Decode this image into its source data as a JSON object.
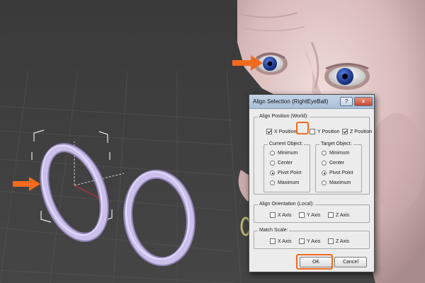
{
  "dialog": {
    "title": "Align Selection (RightEyeBall)",
    "help_label": "?",
    "close_label": "×",
    "align_position": {
      "label": "Align Position (World):",
      "x": {
        "label": "X Position",
        "checked": true
      },
      "y": {
        "label": "Y Position",
        "checked": false
      },
      "z": {
        "label": "Z Position",
        "checked": true
      }
    },
    "current_object": {
      "label": "Current Object:",
      "options": [
        "Minimum",
        "Center",
        "Pivot Point",
        "Maximum"
      ],
      "selected": "Pivot Point"
    },
    "target_object": {
      "label": "Target Object:",
      "options": [
        "Minimum",
        "Center",
        "Pivot Point",
        "Maximum"
      ],
      "selected": "Pivot Point"
    },
    "align_orientation": {
      "label": "Align Orientation (Local):",
      "axes": [
        "X Axis",
        "Y Axis",
        "Z Axis"
      ]
    },
    "match_scale": {
      "label": "Match Scale:",
      "axes": [
        "X Axis",
        "Y Axis",
        "Z Axis"
      ]
    },
    "ok_label": "OK",
    "cancel_label": "Cancel"
  },
  "colors": {
    "viewport_bg": "#3b3b3b",
    "grid": "#555555",
    "ring": "#c8bde8",
    "head": "#dcc0c0",
    "eye_iris": "#1f3fa0",
    "highlight": "#f26b1d"
  }
}
